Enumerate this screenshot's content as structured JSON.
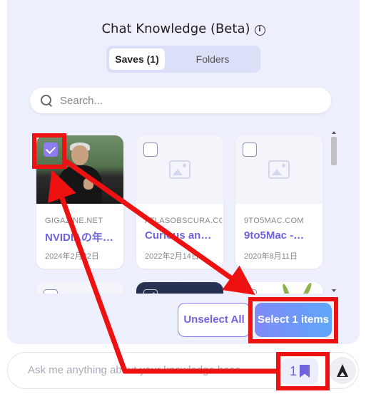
{
  "panel": {
    "title": "Chat Knowledge (Beta)",
    "info_icon": "info-icon"
  },
  "tabs": [
    {
      "label": "Saves (1)",
      "active": true
    },
    {
      "label": "Folders",
      "active": false
    }
  ],
  "search": {
    "placeholder": "Search..."
  },
  "cards": [
    {
      "source": "GIGAZINE.NET",
      "title": "NVIDIAの年…",
      "date": "2024年2月22日",
      "checked": true,
      "thumb": "photo"
    },
    {
      "source": "ATLASOBSCURA.COM",
      "title": "Curious an…",
      "date": "2022年2月14日",
      "checked": false,
      "thumb": "placeholder"
    },
    {
      "source": "9TO5MAC.COM",
      "title": "9to5Mac -…",
      "date": "2020年8月11日",
      "checked": false,
      "thumb": "placeholder"
    }
  ],
  "buttons": {
    "unselect": "Unselect All",
    "select": "Select 1 items"
  },
  "chat": {
    "placeholder": "Ask me anything about your knowledge base",
    "saves_count": "1"
  },
  "colors": {
    "accent": "#6f63e0",
    "annotation": "#ee1111"
  }
}
